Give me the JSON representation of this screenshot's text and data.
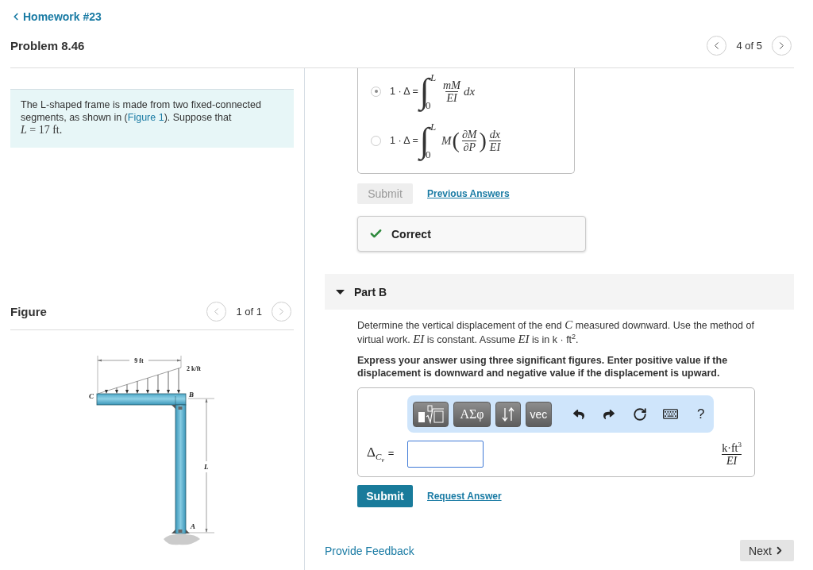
{
  "breadcrumb": {
    "label": "Homework #23"
  },
  "header": {
    "title": "Problem 8.46",
    "pager": {
      "label": "4 of 5",
      "prev_disabled": false,
      "next_disabled": false
    }
  },
  "statement": {
    "text_before": "The L-shaped frame is made from two fixed-connected segments, as shown in (",
    "link": "Figure 1",
    "text_after": "). Suppose that ",
    "math": "*L* = 17 ft."
  },
  "figure": {
    "title": "Figure",
    "pager": {
      "label": "1 of 1",
      "prev_disabled": true,
      "next_disabled": true
    },
    "labels": {
      "span": "9 ft",
      "load": "2 k/ft",
      "end_c": "C",
      "joint_b": "B",
      "height": "L",
      "base_a": "A"
    }
  },
  "part_a": {
    "options": [
      {
        "selected": true,
        "lhs": "1 · Δ =",
        "integral": "∫",
        "upper": "L",
        "lower": "0",
        "terms": [
          {
            "kind": "fraction",
            "num": "mM",
            "den": "EI"
          },
          {
            "kind": "text",
            "text": "dx"
          }
        ]
      },
      {
        "selected": false,
        "lhs": "1 · Δ =",
        "integral": "∫",
        "upper": "L",
        "lower": "0",
        "terms": [
          {
            "kind": "text",
            "text": "M"
          },
          {
            "kind": "group",
            "open": "(",
            "close": ")",
            "num": "∂M",
            "den": "∂P"
          },
          {
            "kind": "fraction",
            "num": "dx",
            "den": "EI"
          }
        ]
      }
    ],
    "submit": {
      "label": "Submit",
      "disabled": true
    },
    "previous_answers": "Previous Answers",
    "feedback": {
      "kind": "correct",
      "label": "Correct"
    }
  },
  "part_b": {
    "title": "Part B",
    "expanded": true,
    "question": "Determine the vertical displacement of the end *C* measured downward. Use the method of virtual work. *EI* is constant. Assume *EI* is in k · ft$^{2}$.",
    "instruction": "Express your answer using three significant figures. Enter positive value if the displacement is downward and negative value if the displacement is upward.",
    "toolbar": [
      {
        "kind": "templates"
      },
      {
        "kind": "symbols",
        "label": "ΑΣφ"
      },
      {
        "kind": "arrows"
      },
      {
        "kind": "vector",
        "label": "vec"
      },
      {
        "kind": "undo"
      },
      {
        "kind": "redo"
      },
      {
        "kind": "reset"
      },
      {
        "kind": "keyboard"
      },
      {
        "kind": "help",
        "label": "?"
      }
    ],
    "answer": {
      "symbol": "Δ",
      "subscript": "C",
      "sub_subscript": "v",
      "equals": "=",
      "units_num": "k·ft$^{3}$",
      "units_den": "EI"
    },
    "submit": {
      "label": "Submit",
      "disabled": false
    },
    "request_answer": "Request Answer"
  },
  "footer": {
    "feedback_link": "Provide Feedback",
    "next": "Next"
  }
}
